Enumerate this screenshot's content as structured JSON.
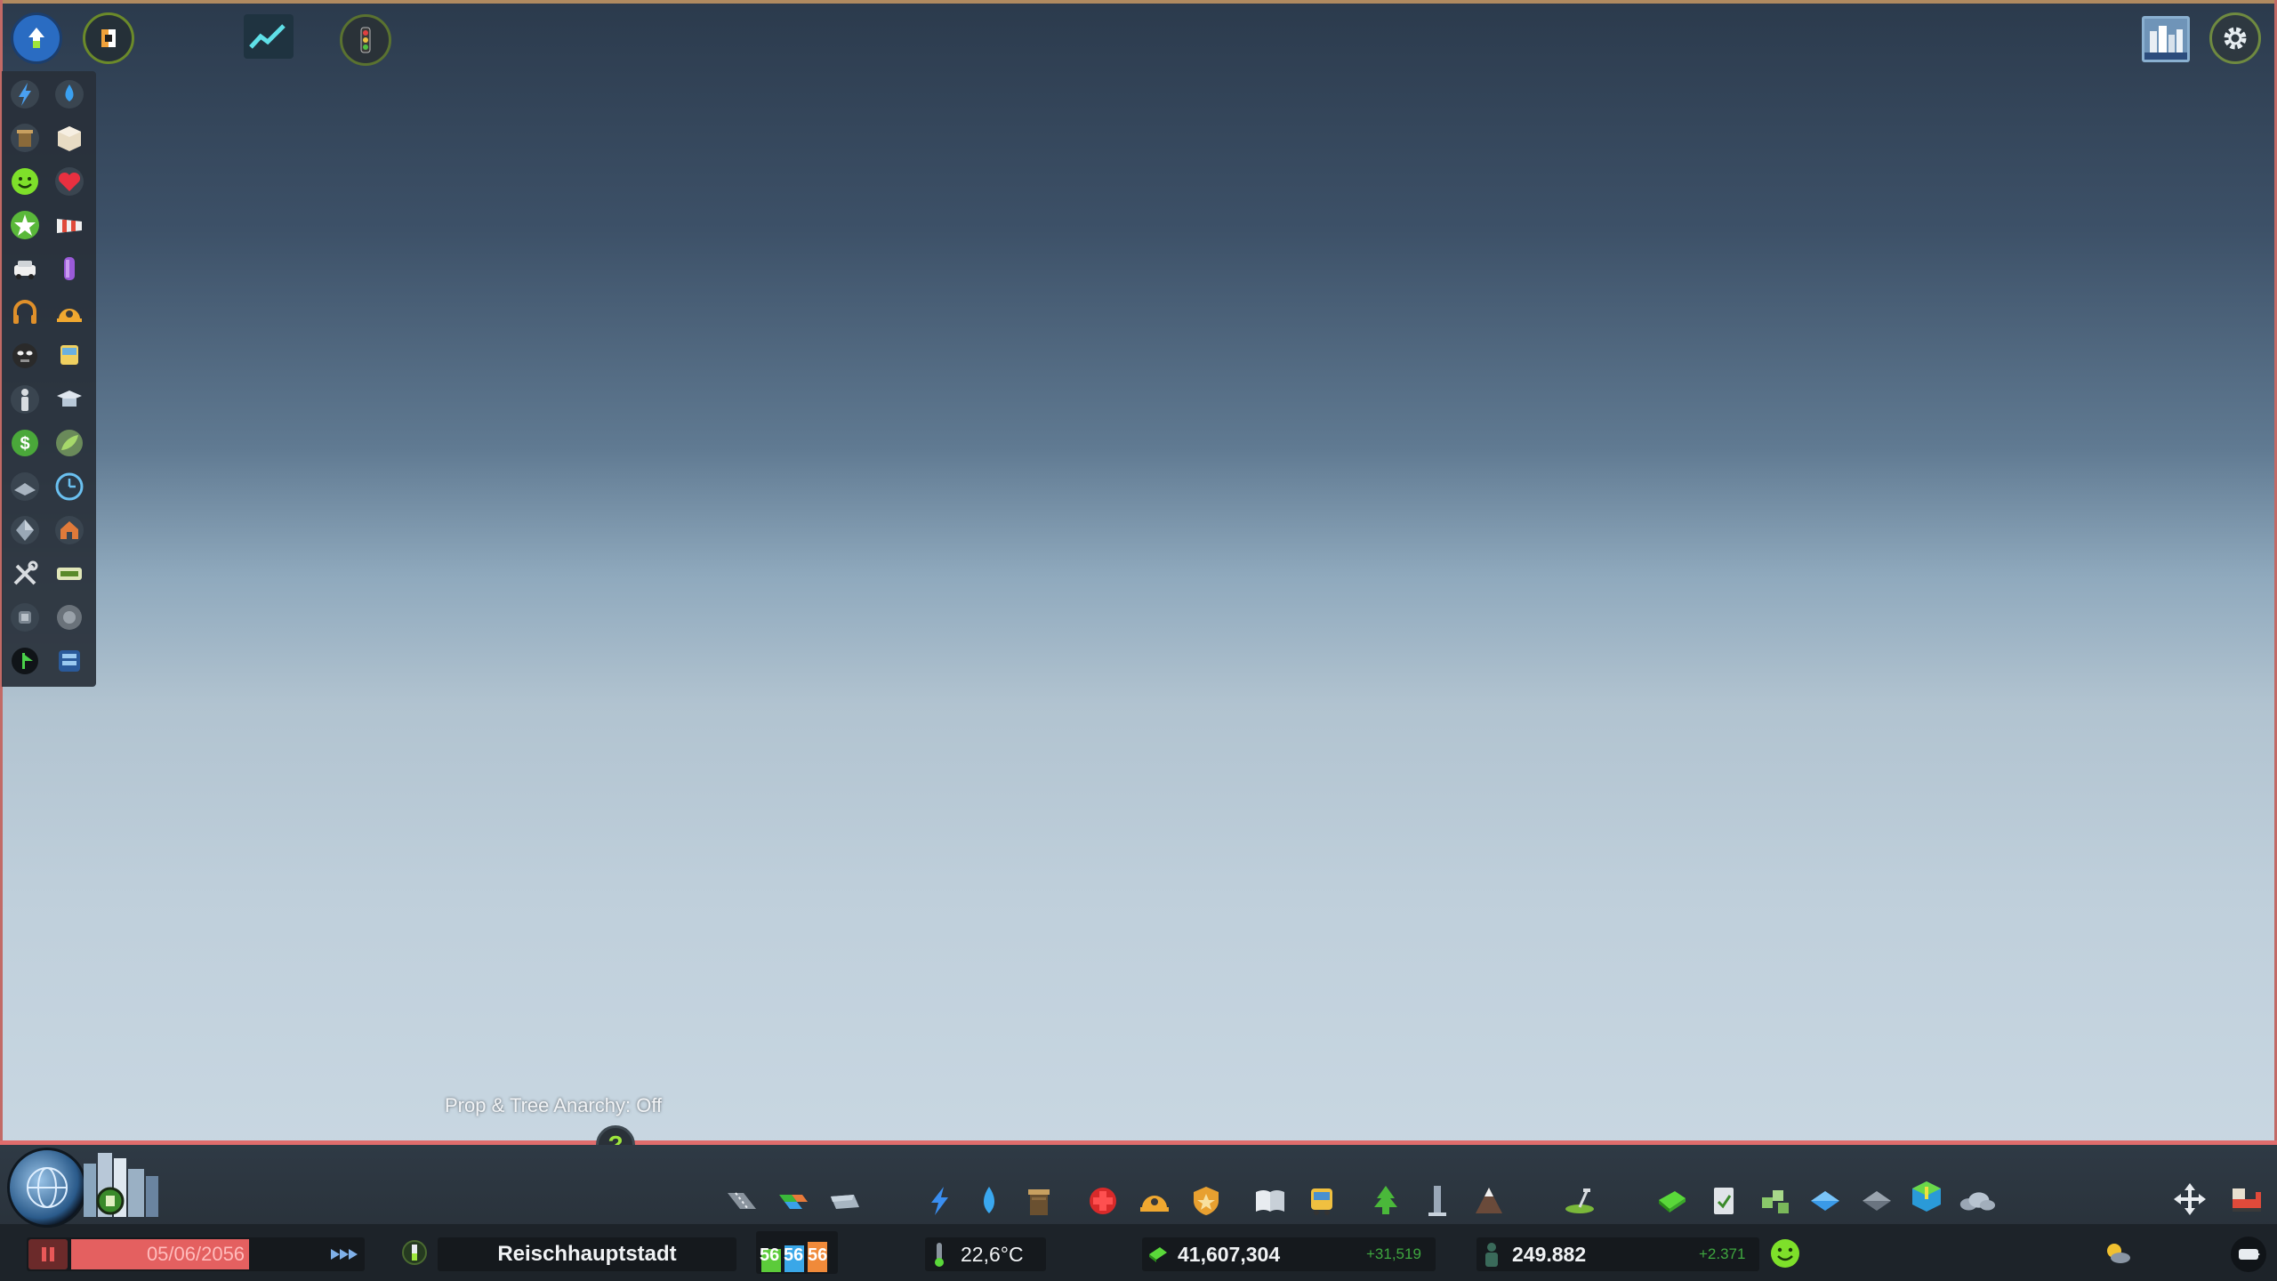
{
  "top_bar": {
    "left_icons": [
      "unlock-icon",
      "info-view-icon",
      "statistics-chart-icon",
      "traffic-light-icon"
    ],
    "right_icons": [
      "city-thumbnail-icon",
      "settings-gear-icon"
    ]
  },
  "sidebar": {
    "items": [
      {
        "left": "electricity-icon",
        "right": "water-icon"
      },
      {
        "left": "garbage-icon",
        "right": "landfill-box-icon"
      },
      {
        "left": "happiness-icon",
        "right": "health-heart-icon"
      },
      {
        "left": "entertainment-star-icon",
        "right": "wind-sock-icon"
      },
      {
        "left": "traffic-car-icon",
        "right": "pollution-tube-icon"
      },
      {
        "left": "noise-headphones-icon",
        "right": "fire-safety-icon"
      },
      {
        "left": "crime-mask-icon",
        "right": "public-transport-icon"
      },
      {
        "left": "population-person-icon",
        "right": "education-icon"
      },
      {
        "left": "economy-dollar-icon",
        "right": "natural-resources-icon"
      },
      {
        "left": "land-value-icon",
        "right": "clock-icon"
      },
      {
        "left": "terrain-height-icon",
        "right": "zoning-house-icon"
      },
      {
        "left": "maintenance-tools-icon",
        "right": "road-maintenance-icon"
      },
      {
        "left": "snow-icon",
        "right": "heating-icon"
      },
      {
        "left": "radio-icon",
        "right": "tourism-icon"
      }
    ]
  },
  "overlay": {
    "anarchy_label": "Prop & Tree Anarchy: Off",
    "help_label": "?"
  },
  "toolbar": {
    "icons": [
      "roads-icon",
      "zoning-icon",
      "districts-icon",
      "electricity-icon",
      "water-icon",
      "garbage-icon",
      "healthcare-icon",
      "fire-icon",
      "police-icon",
      "education-icon",
      "transport-icon",
      "parks-icon",
      "unique-buildings-icon",
      "monuments-icon",
      "landscaping-icon",
      "money-icon",
      "policies-icon",
      "areas-icon",
      "water-ways-icon",
      "terrain-icon",
      "disasters-icon",
      "clouds-icon"
    ],
    "right_icons": [
      "move-arrows-icon",
      "bulldozer-icon"
    ]
  },
  "status": {
    "date": "05/06/2056",
    "city_name": "Reischhauptstadt",
    "rci": {
      "residential": "56",
      "commercial": "56",
      "industrial": "56"
    },
    "temperature": "22,6°C",
    "money": "41,607,304",
    "money_delta": "+31,519",
    "population": "249.882",
    "population_delta": "+2.371"
  },
  "colors": {
    "accent_green": "#9ee63c",
    "date_bar": "#e46060",
    "residential": "#5ccb3a",
    "commercial": "#3aa7e8",
    "industrial": "#f08a3a"
  }
}
